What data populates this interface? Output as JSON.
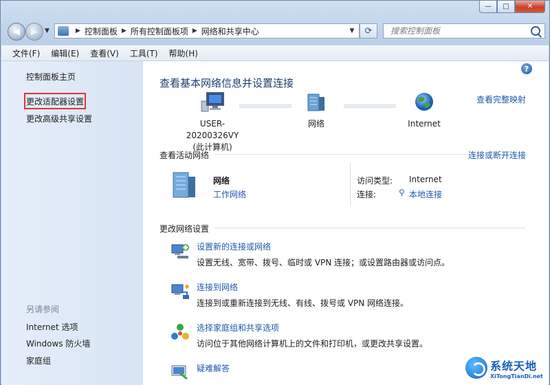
{
  "window": {
    "caption_buttons": {
      "minimize": "—",
      "maximize": "□",
      "close": "✕"
    }
  },
  "nav": {
    "back": "◀",
    "forward": "▶",
    "breadcrumbs": [
      "控制面板",
      "所有控制面板项",
      "网络和共享中心"
    ],
    "search_placeholder": "搜索控制面板",
    "icons": {
      "refresh": "refresh-icon",
      "search": "search-icon"
    }
  },
  "menu": {
    "items": [
      "文件(F)",
      "编辑(E)",
      "查看(V)",
      "工具(T)",
      "帮助(H)"
    ]
  },
  "sidebar": {
    "home": "控制面板主页",
    "links": [
      "更改适配器设置",
      "更改高级共享设置"
    ],
    "see_also_title": "另请参阅",
    "see_also": [
      "Internet 选项",
      "Windows 防火墙",
      "家庭组"
    ]
  },
  "main": {
    "help": "?",
    "title": "查看基本网络信息并设置连接",
    "view_full_map": "查看完整映射",
    "map": {
      "computer_name": "USER-20200326VY",
      "computer_sub": "(此计算机)",
      "network": "网络",
      "internet": "Internet"
    },
    "active_networks_title": "查看活动网络",
    "connect_disconnect": "连接或断开连接",
    "active": {
      "name": "网络",
      "type": "工作网络",
      "access_type_label": "访问类型:",
      "access_type_value": "Internet",
      "connections_label": "连接:",
      "connections_value": "本地连接"
    },
    "change_settings_title": "更改网络设置",
    "tasks": [
      {
        "title": "设置新的连接或网络",
        "desc": "设置无线、宽带、拨号、临时或 VPN 连接；或设置路由器或访问点。"
      },
      {
        "title": "连接到网络",
        "desc": "连接到或重新连接到无线、有线、拨号或 VPN 网络连接。"
      },
      {
        "title": "选择家庭组和共享选项",
        "desc": "访问位于其他网络计算机上的文件和打印机，或更改共享设置。"
      },
      {
        "title": "疑难解答",
        "desc": ""
      }
    ]
  },
  "watermark": {
    "cn": "系统天地",
    "en": "XiTongTianDi.net"
  },
  "colors": {
    "link": "#1f58a8",
    "title": "#1e3d6d",
    "highlight_box": "#e03333"
  }
}
